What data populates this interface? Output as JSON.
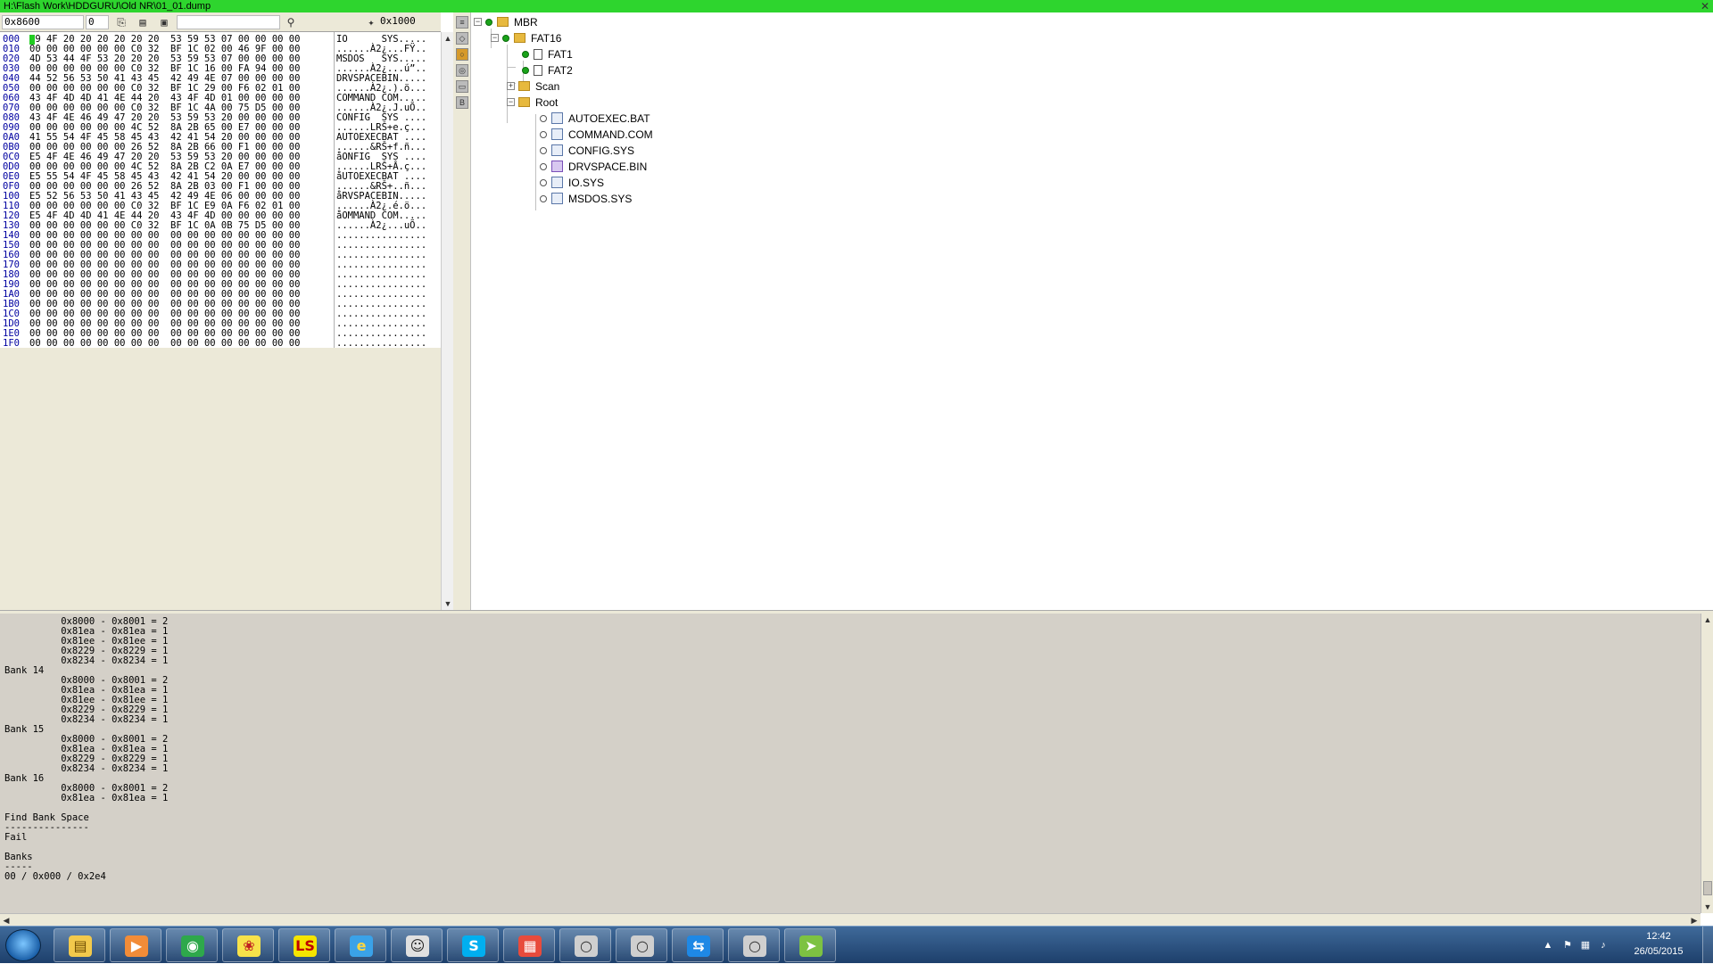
{
  "window": {
    "title": "H:\\Flash Work\\HDDGURU\\Old NR\\01_01.dump"
  },
  "hex_toolbar": {
    "offset": "0x8600",
    "value": "0",
    "size": "0x1000"
  },
  "hex_rows": [
    {
      "addr": "000",
      "bytes": "49 4F 20 20 20 20 20 20  53 59 53 07 00 00 00 00",
      "ascii": "IO      SYS....."
    },
    {
      "addr": "010",
      "bytes": "00 00 00 00 00 00 C0 32  BF 1C 02 00 46 9F 00 00",
      "ascii": "......À2¿...FŸ.."
    },
    {
      "addr": "020",
      "bytes": "4D 53 44 4F 53 20 20 20  53 59 53 07 00 00 00 00",
      "ascii": "MSDOS   SYS....."
    },
    {
      "addr": "030",
      "bytes": "00 00 00 00 00 00 C0 32  BF 1C 16 00 FA 94 00 00",
      "ascii": "......À2¿...ú”.."
    },
    {
      "addr": "040",
      "bytes": "44 52 56 53 50 41 43 45  42 49 4E 07 00 00 00 00",
      "ascii": "DRVSPACEBIN....."
    },
    {
      "addr": "050",
      "bytes": "00 00 00 00 00 00 C0 32  BF 1C 29 00 F6 02 01 00",
      "ascii": "......À2¿.).ö..."
    },
    {
      "addr": "060",
      "bytes": "43 4F 4D 4D 41 4E 44 20  43 4F 4D 01 00 00 00 00",
      "ascii": "COMMAND COM....."
    },
    {
      "addr": "070",
      "bytes": "00 00 00 00 00 00 C0 32  BF 1C 4A 00 75 D5 00 00",
      "ascii": "......À2¿.J.uÕ.."
    },
    {
      "addr": "080",
      "bytes": "43 4F 4E 46 49 47 20 20  53 59 53 20 00 00 00 00",
      "ascii": "CONFIG  SYS ...."
    },
    {
      "addr": "090",
      "bytes": "00 00 00 00 00 00 4C 52  8A 2B 65 00 E7 00 00 00",
      "ascii": "......LRŠ+e.ç..."
    },
    {
      "addr": "0A0",
      "bytes": "41 55 54 4F 45 58 45 43  42 41 54 20 00 00 00 00",
      "ascii": "AUTOEXECBAT ...."
    },
    {
      "addr": "0B0",
      "bytes": "00 00 00 00 00 00 26 52  8A 2B 66 00 F1 00 00 00",
      "ascii": "......&RŠ+f.ñ..."
    },
    {
      "addr": "0C0",
      "bytes": "E5 4F 4E 46 49 47 20 20  53 59 53 20 00 00 00 00",
      "ascii": "åONFIG  SYS ...."
    },
    {
      "addr": "0D0",
      "bytes": "00 00 00 00 00 00 4C 52  8A 2B C2 0A E7 00 00 00",
      "ascii": "......LRŠ+Â.ç..."
    },
    {
      "addr": "0E0",
      "bytes": "E5 55 54 4F 45 58 45 43  42 41 54 20 00 00 00 00",
      "ascii": "åUTOEXECBAT ...."
    },
    {
      "addr": "0F0",
      "bytes": "00 00 00 00 00 00 26 52  8A 2B 03 00 F1 00 00 00",
      "ascii": "......&RŠ+..ñ..."
    },
    {
      "addr": "100",
      "bytes": "E5 52 56 53 50 41 43 45  42 49 4E 06 00 00 00 00",
      "ascii": "åRVSPACEBIN....."
    },
    {
      "addr": "110",
      "bytes": "00 00 00 00 00 00 C0 32  BF 1C E9 0A F6 02 01 00",
      "ascii": "......À2¿.é.ö..."
    },
    {
      "addr": "120",
      "bytes": "E5 4F 4D 4D 41 4E 44 20  43 4F 4D 00 00 00 00 00",
      "ascii": "åOMMAND COM....."
    },
    {
      "addr": "130",
      "bytes": "00 00 00 00 00 00 C0 32  BF 1C 0A 0B 75 D5 00 00",
      "ascii": "......À2¿...uÕ.."
    },
    {
      "addr": "140",
      "bytes": "00 00 00 00 00 00 00 00  00 00 00 00 00 00 00 00",
      "ascii": "................"
    },
    {
      "addr": "150",
      "bytes": "00 00 00 00 00 00 00 00  00 00 00 00 00 00 00 00",
      "ascii": "................"
    },
    {
      "addr": "160",
      "bytes": "00 00 00 00 00 00 00 00  00 00 00 00 00 00 00 00",
      "ascii": "................"
    },
    {
      "addr": "170",
      "bytes": "00 00 00 00 00 00 00 00  00 00 00 00 00 00 00 00",
      "ascii": "................"
    },
    {
      "addr": "180",
      "bytes": "00 00 00 00 00 00 00 00  00 00 00 00 00 00 00 00",
      "ascii": "................"
    },
    {
      "addr": "190",
      "bytes": "00 00 00 00 00 00 00 00  00 00 00 00 00 00 00 00",
      "ascii": "................"
    },
    {
      "addr": "1A0",
      "bytes": "00 00 00 00 00 00 00 00  00 00 00 00 00 00 00 00",
      "ascii": "................"
    },
    {
      "addr": "1B0",
      "bytes": "00 00 00 00 00 00 00 00  00 00 00 00 00 00 00 00",
      "ascii": "................"
    },
    {
      "addr": "1C0",
      "bytes": "00 00 00 00 00 00 00 00  00 00 00 00 00 00 00 00",
      "ascii": "................"
    },
    {
      "addr": "1D0",
      "bytes": "00 00 00 00 00 00 00 00  00 00 00 00 00 00 00 00",
      "ascii": "................"
    },
    {
      "addr": "1E0",
      "bytes": "00 00 00 00 00 00 00 00  00 00 00 00 00 00 00 00",
      "ascii": "................"
    },
    {
      "addr": "1F0",
      "bytes": "00 00 00 00 00 00 00 00  00 00 00 00 00 00 00 00",
      "ascii": "................"
    }
  ],
  "tree": {
    "mbr": "MBR",
    "fat16": "FAT16",
    "fat1": "FAT1",
    "fat2": "FAT2",
    "scan": "Scan",
    "root": "Root",
    "files": [
      "AUTOEXEC.BAT",
      "COMMAND.COM",
      "CONFIG.SYS",
      "DRVSPACE.BIN",
      "IO.SYS",
      "MSDOS.SYS"
    ]
  },
  "log_lines": [
    "          0x8000 - 0x8001 = 2",
    "          0x81ea - 0x81ea = 1",
    "          0x81ee - 0x81ee = 1",
    "          0x8229 - 0x8229 = 1",
    "          0x8234 - 0x8234 = 1",
    "Bank 14",
    "          0x8000 - 0x8001 = 2",
    "          0x81ea - 0x81ea = 1",
    "          0x81ee - 0x81ee = 1",
    "          0x8229 - 0x8229 = 1",
    "          0x8234 - 0x8234 = 1",
    "Bank 15",
    "          0x8000 - 0x8001 = 2",
    "          0x81ea - 0x81ea = 1",
    "          0x8229 - 0x8229 = 1",
    "          0x8234 - 0x8234 = 1",
    "Bank 16",
    "          0x8000 - 0x8001 = 2",
    "          0x81ea - 0x81ea = 1",
    "",
    "Find Bank Space",
    "---------------",
    "Fail",
    "",
    "Banks",
    "-----",
    "00 / 0x000 / 0x2e4"
  ],
  "taskbar": {
    "apps": [
      "explorer-icon",
      "media-player-icon",
      "chrome-icon",
      "game-icon",
      "ls-icon",
      "ie-icon",
      "cat-icon",
      "skype-icon",
      "flag-icon",
      "circle-app-icon",
      "circle-app-icon",
      "teamviewer-icon",
      "circle-app-icon",
      "plane-icon"
    ],
    "clock_time": "12:42",
    "clock_date": "26/05/2015"
  },
  "colors": {
    "titlebar": "#2ed52e",
    "address": "#0000a0",
    "taskbar": "#1d3f6b"
  }
}
